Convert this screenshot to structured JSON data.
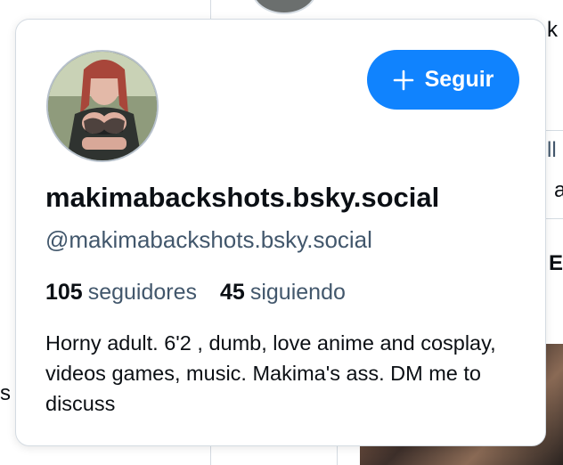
{
  "background": {
    "fragments": [
      "k",
      "ll",
      "a",
      "E",
      "s"
    ]
  },
  "card": {
    "follow_label": "Seguir",
    "display_name": "makimabackshots.bsky.social",
    "handle": "@makimabackshots.bsky.social",
    "followers_count": "105",
    "followers_label": "seguidores",
    "following_count": "45",
    "following_label": "siguiendo",
    "bio": "Horny adult. 6'2 , dumb, love anime and cosplay, videos games, music. Makima's ass. DM me to discuss"
  },
  "colors": {
    "accent": "#1083fe",
    "text": "#0b0f14",
    "muted": "#42576c",
    "border": "#d4dbe2"
  }
}
